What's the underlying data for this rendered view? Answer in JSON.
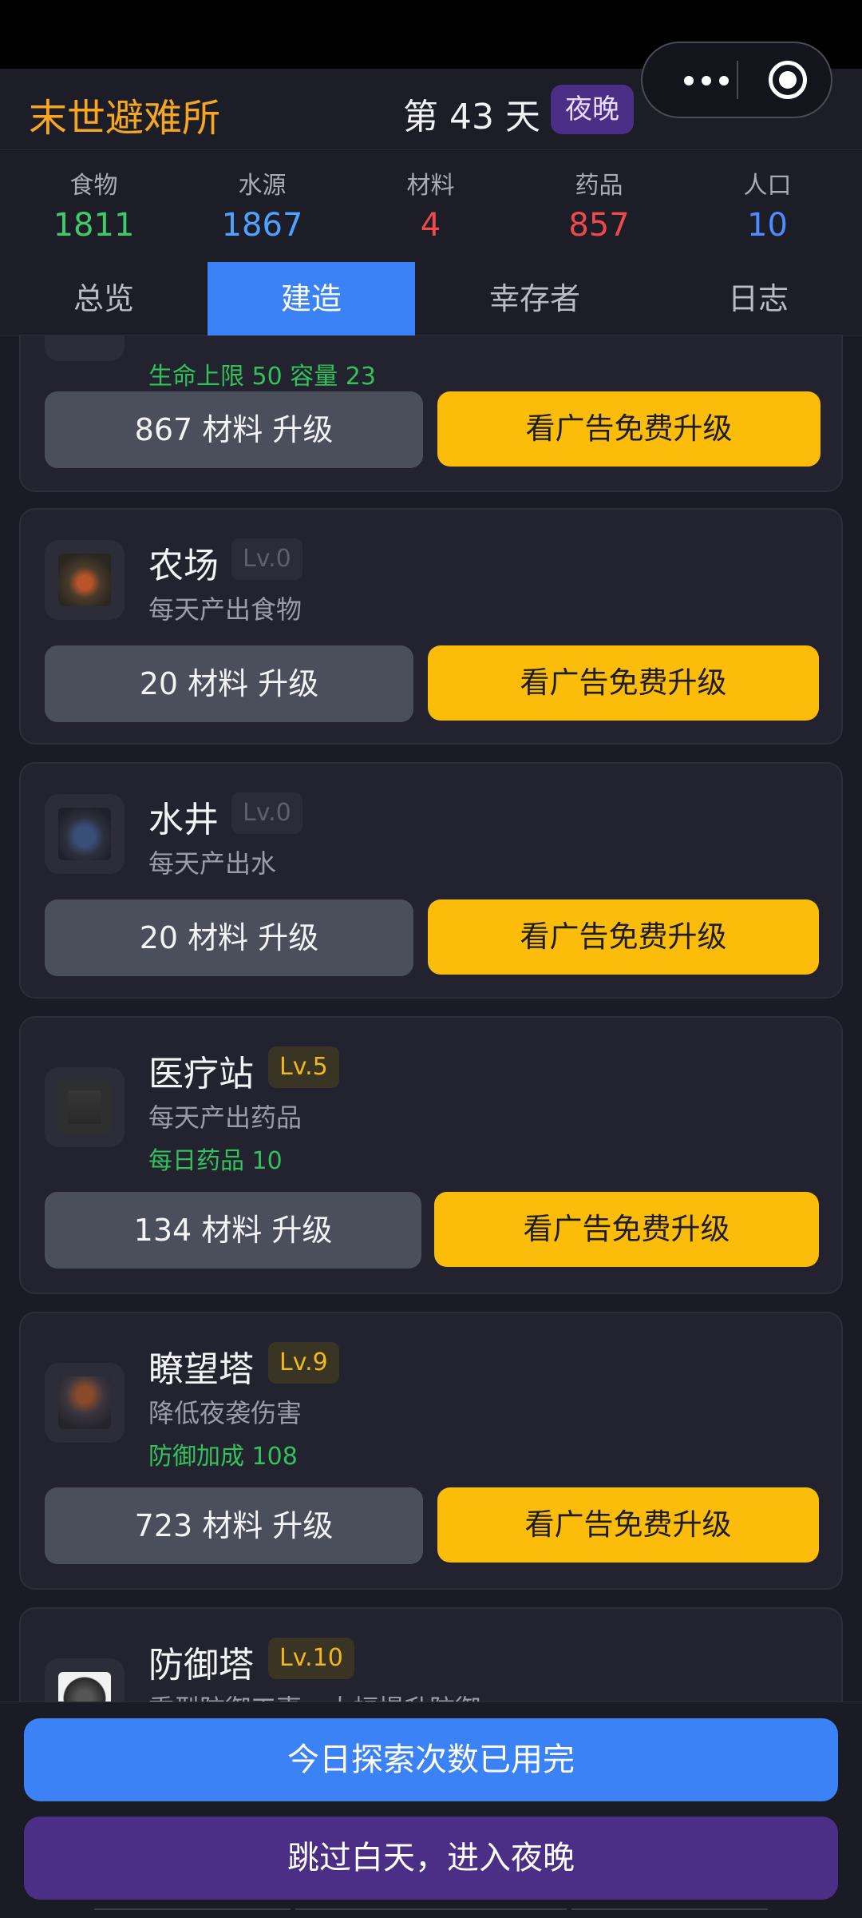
{
  "header": {
    "app_title": "末世避难所",
    "day_label": "第 43 天",
    "phase": "夜晚"
  },
  "capsule": {
    "more_icon": "more-dots-icon",
    "close_icon": "target-icon"
  },
  "resources": [
    {
      "label": "食物",
      "value": "1811",
      "color": "#3ecb6a"
    },
    {
      "label": "水源",
      "value": "1867",
      "color": "#4ea3ff"
    },
    {
      "label": "材料",
      "value": "4",
      "color": "#ef4a4a"
    },
    {
      "label": "药品",
      "value": "857",
      "color": "#ef4a4a"
    },
    {
      "label": "人口",
      "value": "10",
      "color": "#4e8cff"
    }
  ],
  "tabs": [
    {
      "label": "总览",
      "active": false
    },
    {
      "label": "建造",
      "active": true
    },
    {
      "label": "幸存者",
      "active": false
    },
    {
      "label": "日志",
      "active": false
    }
  ],
  "partial_card": {
    "bonus": "生命上限 50  容量 23",
    "upgrade_label": "867 材料 升级",
    "ad_label": "看广告免费升级"
  },
  "buildings": [
    {
      "name": "农场",
      "level": "Lv.0",
      "desc": "每天产出食物",
      "bonus": "",
      "upgrade_label": "20 材料 升级",
      "ad_label": "看广告免费升级",
      "icon": "farm-icon"
    },
    {
      "name": "水井",
      "level": "Lv.0",
      "desc": "每天产出水",
      "bonus": "",
      "upgrade_label": "20 材料 升级",
      "ad_label": "看广告免费升级",
      "icon": "well-icon"
    },
    {
      "name": "医疗站",
      "level": "Lv.5",
      "desc": "每天产出药品",
      "bonus": "每日药品 10",
      "upgrade_label": "134 材料 升级",
      "ad_label": "看广告免费升级",
      "icon": "medical-icon"
    },
    {
      "name": "瞭望塔",
      "level": "Lv.9",
      "desc": "降低夜袭伤害",
      "bonus": "防御加成 108",
      "upgrade_label": "723 材料 升级",
      "ad_label": "看广告免费升级",
      "icon": "watchtower-icon"
    },
    {
      "name": "防御塔",
      "level": "Lv.10",
      "desc": "重型防御工事，大幅提升防御",
      "bonus": "",
      "upgrade_label": "",
      "ad_label": "",
      "icon": "defense-tower-icon"
    }
  ],
  "bottom": {
    "explore_label": "今日探索次数已用完",
    "night_label": "跳过白天，进入夜晚"
  }
}
